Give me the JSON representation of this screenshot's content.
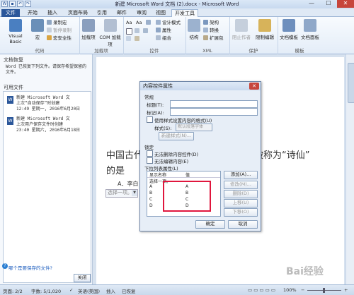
{
  "window": {
    "title": "新建 Microsoft Word 文档 (2).docx - Microsoft Word",
    "min_glyph": "—",
    "max_glyph": "☐",
    "close_glyph": "✕"
  },
  "tabs": [
    "文件",
    "开始",
    "插入",
    "页面布局",
    "引用",
    "邮件",
    "审阅",
    "视图",
    "开发工具"
  ],
  "ribbon": {
    "groups": {
      "code": "代码",
      "addins": "加载项",
      "controls": "控件",
      "xml": "XML",
      "protect": "保护",
      "templates": "模板"
    },
    "code": {
      "visual_basic": "Visual Basic",
      "macros": "宏",
      "record_macro": "录制宏",
      "pause_recording": "暂停录制",
      "macro_security": "宏安全性"
    },
    "addins": {
      "addins": "加载项",
      "com_addins": "COM 加载项"
    },
    "controls": {
      "design_mode": "设计模式",
      "properties": "属性",
      "group": "组合"
    },
    "xml": {
      "structure": "结构",
      "schema": "架构",
      "transform": "转换",
      "expansion_packs": "扩展包"
    },
    "protect": {
      "block_authors": "阻止作者",
      "restrict_editing": "限制编辑"
    },
    "templates": {
      "document_template": "文档模板",
      "document_panel": "文档面板"
    }
  },
  "recovery_pane": {
    "title": "文档恢复",
    "description": "Word 已恢复下列文件。请保存希望保留的文件。",
    "available_files_label": "可用文件",
    "files": [
      {
        "name": "新建 Microsoft Word 文",
        "status": "上次“自动保存”时创建",
        "time": "12:49 星期一, 2016年6月20日"
      },
      {
        "name": "新建 Microsoft Word 文",
        "status": "上次用户保存文件时创建",
        "time": "23:40 星期六, 2016年6月18日"
      }
    ],
    "which_file_link": "哪个是要保存的文件?",
    "close_button": "关闭"
  },
  "document": {
    "line1_left": "中国古代著",
    "line1_right": "被称为“诗仙”",
    "line2": "的是",
    "option_a": "A．李白",
    "dropdown_placeholder": "选择一项。"
  },
  "dialog": {
    "title": "内容控件属性",
    "general_section": "常规",
    "title_label": "标题(T):",
    "tag_label": "标记(A):",
    "use_style_label": "使用样式设置内容的格式(U)",
    "style_label": "样式(S):",
    "style_value": "默认段落字体",
    "new_style_button": "新建样式(N)...",
    "locking_section": "锁定",
    "cannot_delete_label": "无法删除内容控件(D)",
    "cannot_edit_label": "无法编辑内容(E)",
    "dropdown_props_section": "下拉列表属性(L)",
    "col_display_name": "显示名称",
    "col_value": "值",
    "list_items": [
      {
        "display": "选择一项。",
        "value": ""
      },
      {
        "display": "A",
        "value": "A"
      },
      {
        "display": "B",
        "value": "B"
      },
      {
        "display": "C",
        "value": "C"
      },
      {
        "display": "D",
        "value": "D"
      }
    ],
    "add_button": "添加(A)...",
    "modify_button": "修改(M)...",
    "delete_button": "删除(D)",
    "move_up_button": "上移(U)",
    "move_down_button": "下移(O)",
    "ok_button": "确定",
    "cancel_button": "取消"
  },
  "status_bar": {
    "page": "页面: 2/2",
    "words": "字数: 5/1,020",
    "language": "英语(美国)",
    "insert": "插入",
    "recorded": "已恢复",
    "zoom": "100%"
  },
  "watermark": "Bai经验"
}
